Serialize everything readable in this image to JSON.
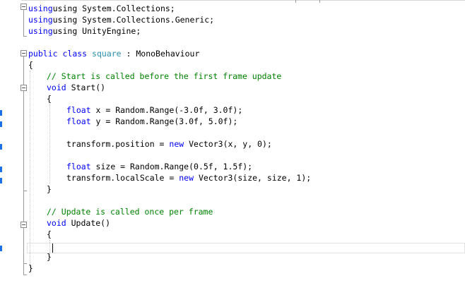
{
  "editor": {
    "lines": {
      "l1": {
        "a": "using System.Collections;"
      },
      "l2": {
        "a": "using System.Collections.Generic;"
      },
      "l3": {
        "a": "using UnityEngine;"
      },
      "l5": {
        "k1": "public",
        "k2": "class",
        "t1": "square",
        "a": " : MonoBehaviour"
      },
      "l6": {
        "a": "{"
      },
      "l7": {
        "c": "// Start is called before the first frame update"
      },
      "l8": {
        "k1": "void",
        "a": " Start()"
      },
      "l9": {
        "a": "{"
      },
      "l10": {
        "k1": "float",
        "a": " x = Random.Range(-3.0f, 3.0f);"
      },
      "l11": {
        "k1": "float",
        "a": " y = Random.Range(3.0f, 5.0f);"
      },
      "l13": {
        "a": "transform.position = ",
        "k1": "new",
        "b": " Vector3(x, y, 0);"
      },
      "l15": {
        "k1": "float",
        "a": " size = Random.Range(0.5f, 1.5f);"
      },
      "l16": {
        "a": "transform.localScale = ",
        "k1": "new",
        "b": " Vector3(size, size, 1);"
      },
      "l17": {
        "a": "}"
      },
      "l19": {
        "c": "// Update is called once per frame"
      },
      "l20": {
        "k1": "void",
        "a": " Update()"
      },
      "l21": {
        "a": "{"
      },
      "l23": {
        "a": "}"
      },
      "l24": {
        "a": "}"
      }
    }
  }
}
